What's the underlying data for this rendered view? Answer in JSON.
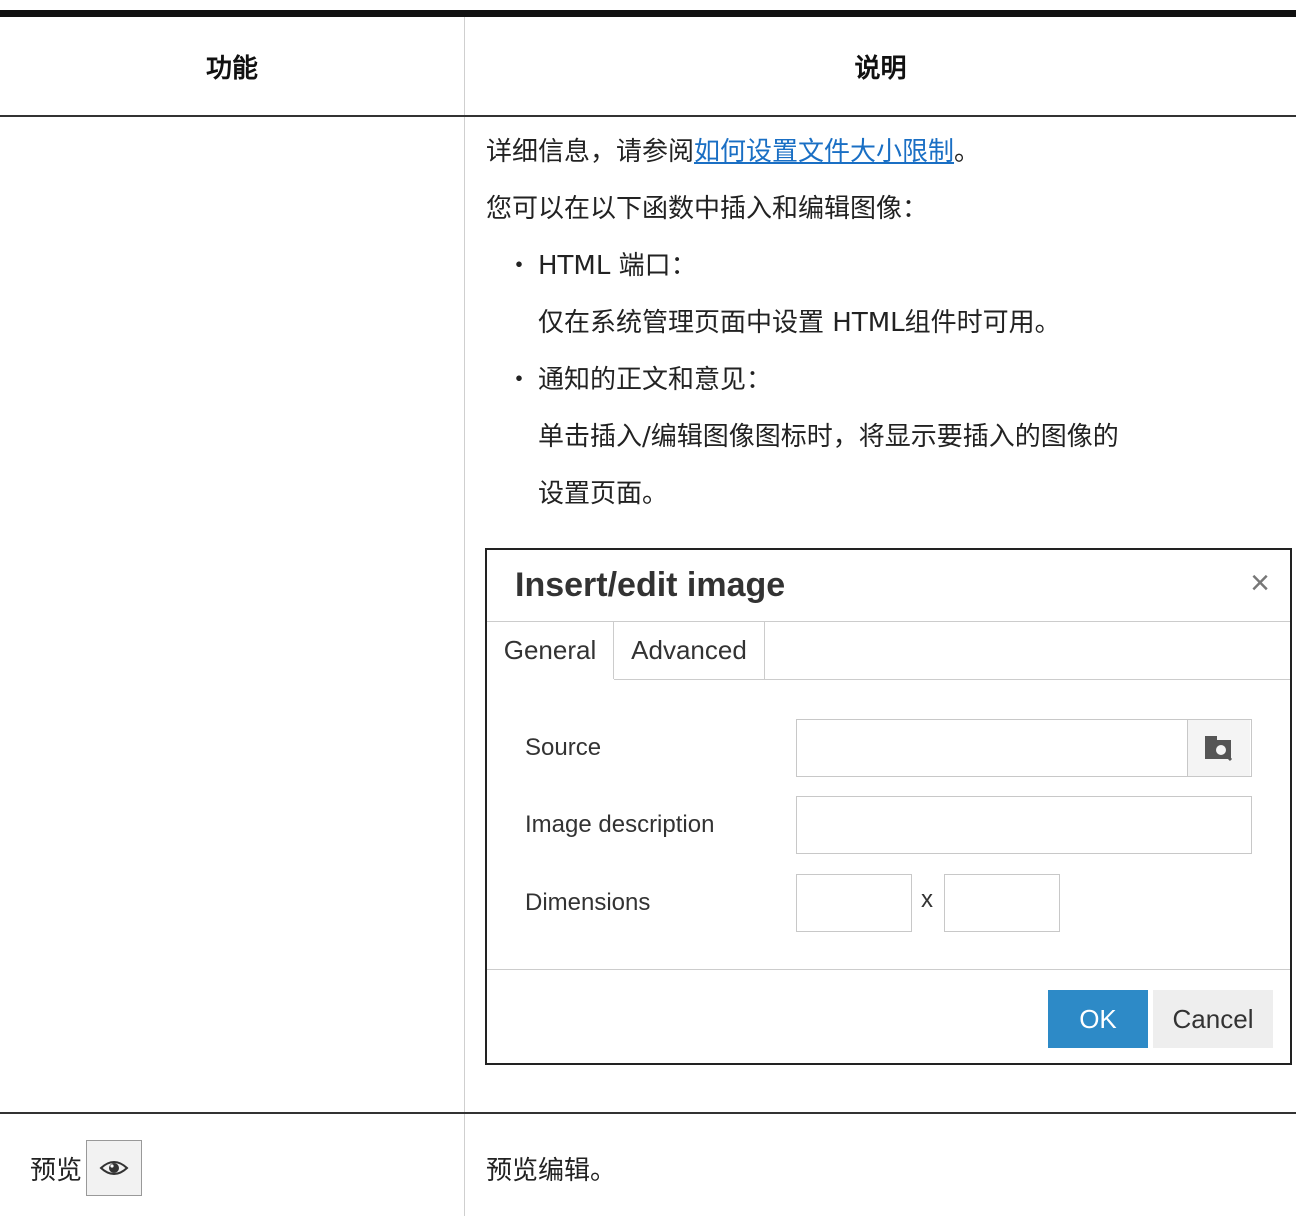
{
  "table": {
    "headers": {
      "function": "功能",
      "description": "说明"
    },
    "row1": {
      "lines": {
        "detail_prefix": "详细信息，请参阅",
        "detail_link": "如何设置文件大小限制",
        "detail_suffix": "。",
        "intro": "您可以在以下函数中插入和编辑图像：",
        "bullet1_title": "HTML 端口：",
        "bullet1_desc": "仅在系统管理页面中设置 HTML组件时可用。",
        "bullet2_title": "通知的正文和意见：",
        "bullet2_desc_1": "单击插入/编辑图像图标时，将显示要插入的图像的",
        "bullet2_desc_2": "设置页面。",
        "bullet_char": "・"
      }
    },
    "row2": {
      "function_label": "预览",
      "function_icon": "eye-icon",
      "description": "预览编辑。"
    }
  },
  "dialog": {
    "title": "Insert/edit image",
    "close_glyph": "×",
    "tabs": [
      "General",
      "Advanced"
    ],
    "active_tab": "General",
    "fields": {
      "source_label": "Source",
      "source_value": "",
      "description_label": "Image description",
      "description_value": "",
      "dimensions_label": "Dimensions",
      "width_value": "",
      "height_value": "",
      "separator": "x"
    },
    "browse_icon": "folder-search-icon",
    "ok_label": "OK",
    "cancel_label": "Cancel"
  }
}
